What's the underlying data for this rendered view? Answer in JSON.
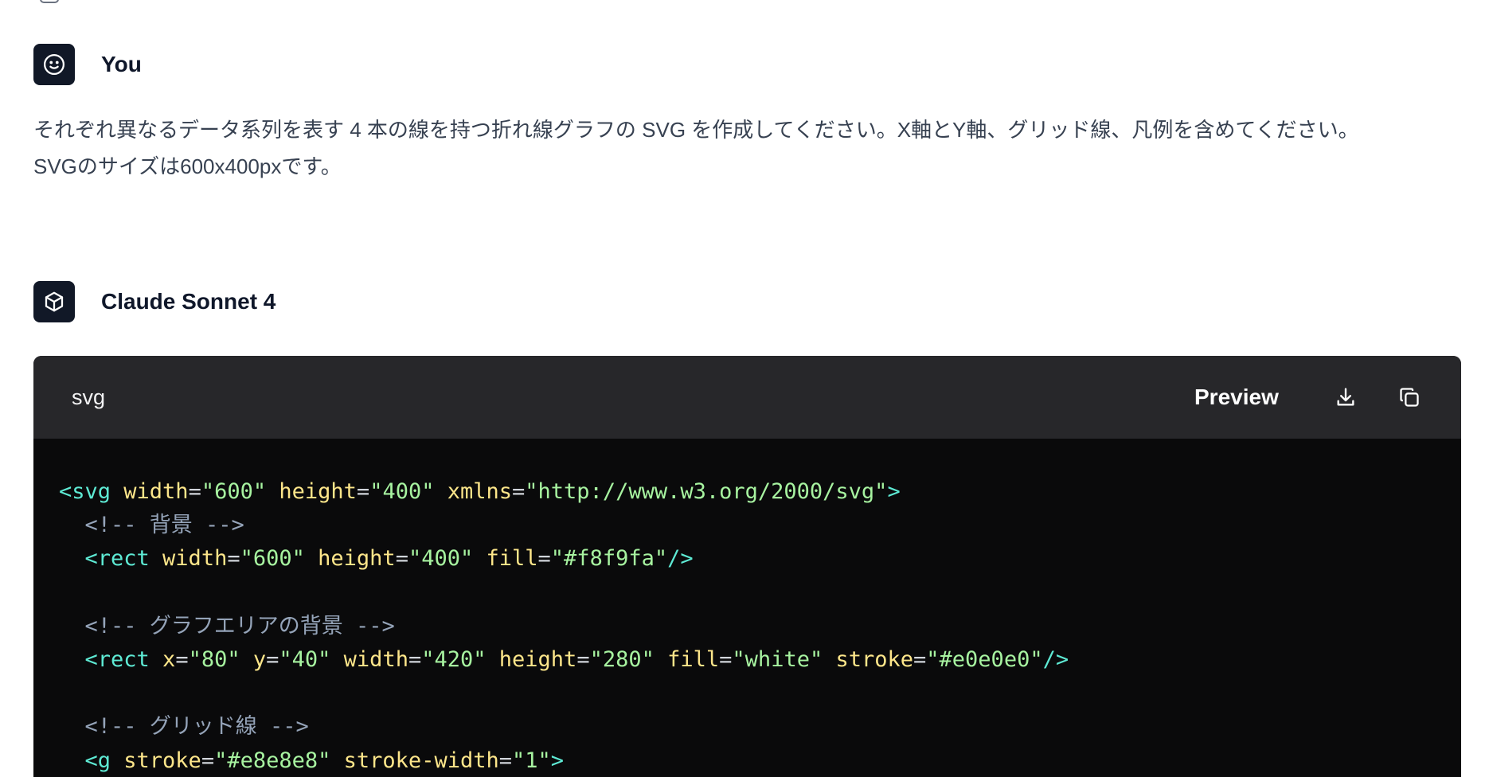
{
  "messages": {
    "user": {
      "name": "You",
      "icon": "smiley-icon",
      "text_lines": [
        "それぞれ異なるデータ系列を表す 4 本の線を持つ折れ線グラフの SVG を作成してください。X軸とY軸、グリッド線、凡例を含めてください。",
        "SVGのサイズは600x400pxです。"
      ]
    },
    "assistant": {
      "name": "Claude Sonnet 4",
      "icon": "cube-icon"
    }
  },
  "code_block": {
    "language": "svg",
    "preview_label": "Preview",
    "download_icon": "download-icon",
    "copy_icon": "copy-icon",
    "lines": [
      [
        [
          "tag",
          "<svg "
        ],
        [
          "attr",
          "width"
        ],
        [
          "eq",
          "="
        ],
        [
          "val",
          "\"600\" "
        ],
        [
          "attr",
          "height"
        ],
        [
          "eq",
          "="
        ],
        [
          "val",
          "\"400\" "
        ],
        [
          "attr",
          "xmlns"
        ],
        [
          "eq",
          "="
        ],
        [
          "val",
          "\"http://www.w3.org/2000/svg\""
        ],
        [
          "tag",
          ">"
        ]
      ],
      [
        [
          "comment",
          "  <!-- 背景 -->"
        ]
      ],
      [
        [
          "tag",
          "  <rect "
        ],
        [
          "attr",
          "width"
        ],
        [
          "eq",
          "="
        ],
        [
          "val",
          "\"600\" "
        ],
        [
          "attr",
          "height"
        ],
        [
          "eq",
          "="
        ],
        [
          "val",
          "\"400\" "
        ],
        [
          "attr",
          "fill"
        ],
        [
          "eq",
          "="
        ],
        [
          "val",
          "\"#f8f9fa\""
        ],
        [
          "tag",
          "/>"
        ]
      ],
      [],
      [
        [
          "comment",
          "  <!-- グラフエリアの背景 -->"
        ]
      ],
      [
        [
          "tag",
          "  <rect "
        ],
        [
          "attr",
          "x"
        ],
        [
          "eq",
          "="
        ],
        [
          "val",
          "\"80\" "
        ],
        [
          "attr",
          "y"
        ],
        [
          "eq",
          "="
        ],
        [
          "val",
          "\"40\" "
        ],
        [
          "attr",
          "width"
        ],
        [
          "eq",
          "="
        ],
        [
          "val",
          "\"420\" "
        ],
        [
          "attr",
          "height"
        ],
        [
          "eq",
          "="
        ],
        [
          "val",
          "\"280\" "
        ],
        [
          "attr",
          "fill"
        ],
        [
          "eq",
          "="
        ],
        [
          "val",
          "\"white\" "
        ],
        [
          "attr",
          "stroke"
        ],
        [
          "eq",
          "="
        ],
        [
          "val",
          "\"#e0e0e0\""
        ],
        [
          "tag",
          "/>"
        ]
      ],
      [],
      [
        [
          "comment",
          "  <!-- グリッド線 -->"
        ]
      ],
      [
        [
          "tag",
          "  <g "
        ],
        [
          "attr",
          "stroke"
        ],
        [
          "eq",
          "="
        ],
        [
          "val",
          "\"#e8e8e8\" "
        ],
        [
          "attr",
          "stroke-width"
        ],
        [
          "eq",
          "="
        ],
        [
          "val",
          "\"1\""
        ],
        [
          "tag",
          ">"
        ]
      ]
    ]
  },
  "colors": {
    "avatar_bg": "#111827",
    "code_header_bg": "#27272a",
    "code_body_bg": "#0a0a0b",
    "tag": "#5eead4",
    "attr": "#fde68a",
    "value": "#a7f3a0",
    "comment": "#94a3b8"
  }
}
